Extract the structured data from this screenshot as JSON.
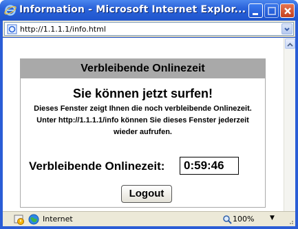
{
  "window": {
    "title": "Information - Microsoft Internet Explor...",
    "icon": "ie-logo-icon"
  },
  "address": {
    "url": "http://1.1.1.1/info.html"
  },
  "panel": {
    "header": "Verbleibende Onlinezeit",
    "headline": "Sie können jetzt surfen!",
    "info": "Dieses Fenster zeigt Ihnen die noch verbleibende Onlinezeit. Unter http://1.1.1.1/info können Sie dieses Fenster jederzeit wieder aufrufen.",
    "time_label": "Verbleibende Onlinezeit:",
    "time_value": "0:59:46",
    "logout_label": "Logout"
  },
  "status": {
    "zone": "Internet",
    "zoom": "100%"
  },
  "colors": {
    "titlebar": "#2b63da",
    "panel_header": "#a9a9a9",
    "chrome": "#ece9d8"
  }
}
